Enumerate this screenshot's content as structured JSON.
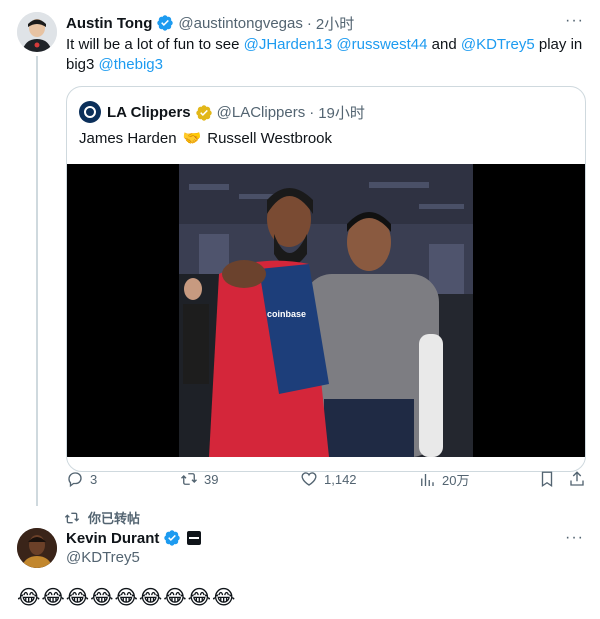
{
  "tweet": {
    "author_name": "Austin Tong",
    "author_handle": "@austintongvegas",
    "separator": "·",
    "time": "2小时",
    "more_label": "···",
    "text_before": "It will be a lot of fun to see ",
    "mention_1": "@JHarden13",
    "mention_2": "@russwest44",
    "text_and": " and ",
    "mention_3": "@KDTrey5",
    "text_play": " play in big3 ",
    "mention_4": "@thebig3"
  },
  "quoted_tweet": {
    "author_name": "LA Clippers",
    "author_handle": "@LAClippers",
    "separator": "·",
    "time": "19小时",
    "text_left": "James Harden",
    "text_emoji": "🤝",
    "text_right": "Russell Westbrook",
    "media_sponsor_text": "coinbase"
  },
  "actions": {
    "replies": "3",
    "retweets": "39",
    "likes": "1,142",
    "views": "20万"
  },
  "retweet_banner": {
    "label": "你已转帖"
  },
  "reply_tweet": {
    "author_name": "Kevin Durant",
    "author_handle": "@KDTrey5",
    "more_label": "···",
    "text": "😂😂😂😂😂😂😂😂😂"
  },
  "colors": {
    "accent": "#1d9bf0",
    "text_primary": "#0f1419",
    "text_secondary": "#536471",
    "border": "#cfd9de",
    "verified_gold": "#e2b719"
  }
}
